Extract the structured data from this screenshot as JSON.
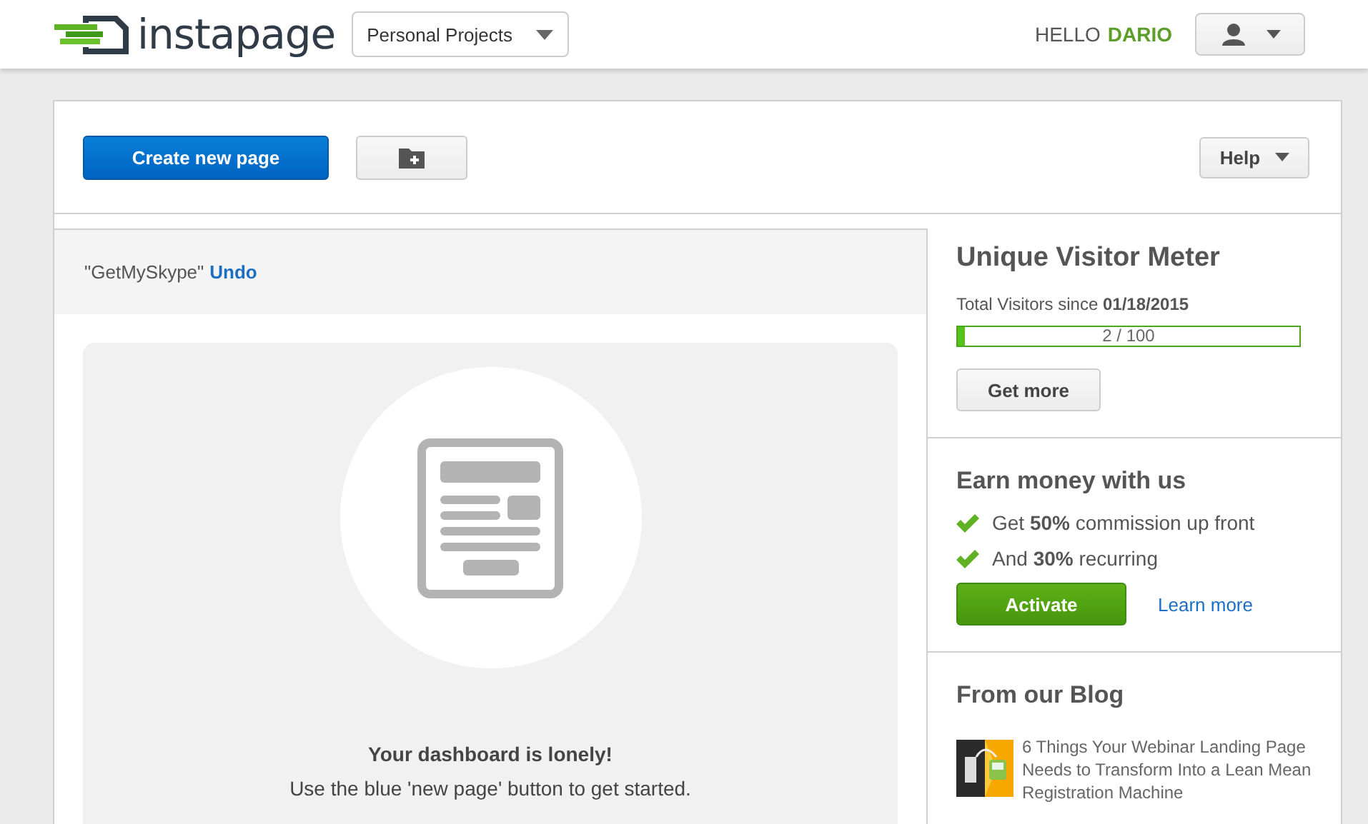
{
  "header": {
    "logo": "instapage",
    "project_select": {
      "value": "Personal Projects"
    },
    "greeting": "HELLO",
    "user_name": "DARIO"
  },
  "toolbar": {
    "create_button": "Create new page",
    "help_button": "Help"
  },
  "notice": {
    "text": "\"GetMySkype\"",
    "action": "Undo"
  },
  "empty_state": {
    "title": "Your dashboard is lonely!",
    "message": "Use the blue 'new page' button to get started."
  },
  "visitor_meter": {
    "title": "Unique Visitor Meter",
    "since_label": "Total Visitors since",
    "since_date": "01/18/2015",
    "level": 0.02,
    "reading": "2 / 100",
    "button": "Get more"
  },
  "earn": {
    "title": "Earn money with us",
    "points": [
      "Get **50%** commission up front",
      "And **30%** recurring"
    ],
    "button": "Activate",
    "link": "Learn more"
  },
  "blog": {
    "title": "From our Blog",
    "posts": [
      {
        "kind": "picture",
        "title": "6 Things Your Webinar Landing Page Needs to Transform Into a Lean Mean Registration Machine"
      }
    ]
  }
}
